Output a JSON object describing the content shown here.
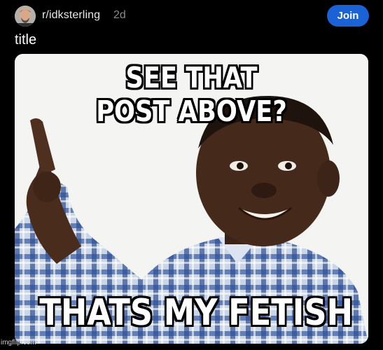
{
  "post": {
    "subreddit": "r/idksterling",
    "age": "2d",
    "join_label": "Join",
    "title": "title"
  },
  "meme": {
    "caption_top_line1": "SEE THAT",
    "caption_top_line2": "POST ABOVE?",
    "caption_bottom": "THATS MY FETISH"
  },
  "watermark": "imgflip.com",
  "colors": {
    "background": "#000000",
    "join_button": "#1a62d6",
    "age_text": "#8a8a8a"
  },
  "icons": {
    "avatar": "subreddit-avatar"
  }
}
